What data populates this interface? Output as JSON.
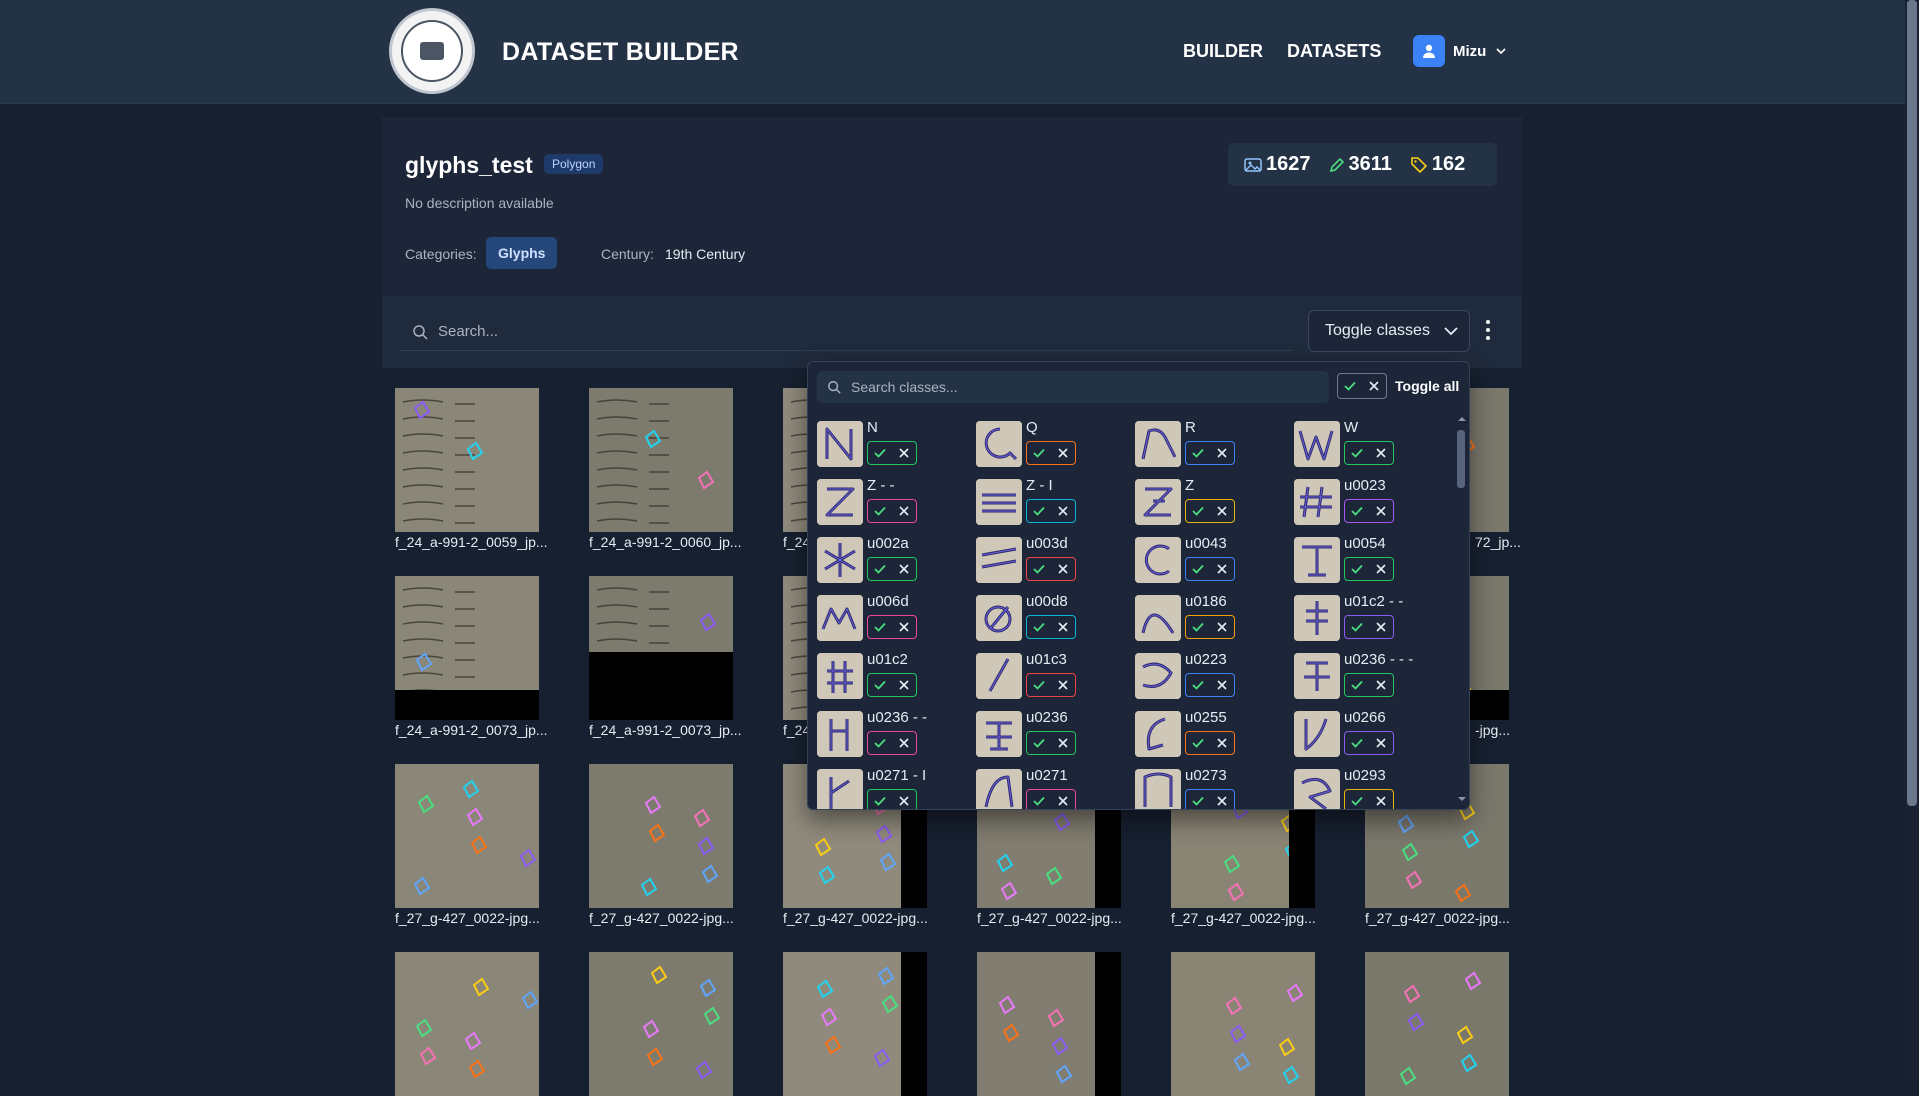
{
  "header": {
    "app_title": "DATASET BUILDER",
    "nav": [
      "BUILDER",
      "DATASETS"
    ],
    "user_name": "Mizu"
  },
  "dataset": {
    "name": "glyphs_test",
    "type_badge": "Polygon",
    "description": "No description available",
    "categories_label": "Categories:",
    "category": "Glyphs",
    "century_label": "Century:",
    "century": "19th Century",
    "stats": {
      "images": "1627",
      "annotations": "3611",
      "classes": "162"
    }
  },
  "toolbar": {
    "search_placeholder": "Search...",
    "toggle_classes_label": "Toggle classes"
  },
  "class_dropdown": {
    "search_placeholder": "Search classes...",
    "toggle_all_label": "Toggle all",
    "classes": [
      {
        "name": "N",
        "color": "#22c55e"
      },
      {
        "name": "Q",
        "color": "#f97316"
      },
      {
        "name": "R",
        "color": "#3b82f6"
      },
      {
        "name": "W",
        "color": "#22c55e"
      },
      {
        "name": "Z - -",
        "color": "#ec4899"
      },
      {
        "name": "Z - I",
        "color": "#06b6d4"
      },
      {
        "name": "Z",
        "color": "#eab308"
      },
      {
        "name": "u0023",
        "color": "#a855f7"
      },
      {
        "name": "u002a",
        "color": "#22c55e"
      },
      {
        "name": "u003d",
        "color": "#ef4444"
      },
      {
        "name": "u0043",
        "color": "#3b82f6"
      },
      {
        "name": "u0054",
        "color": "#22c55e"
      },
      {
        "name": "u006d",
        "color": "#ec4899"
      },
      {
        "name": "u00d8",
        "color": "#06b6d4"
      },
      {
        "name": "u0186",
        "color": "#f59e0b"
      },
      {
        "name": "u01c2 - -",
        "color": "#8b5cf6"
      },
      {
        "name": "u01c2",
        "color": "#22c55e"
      },
      {
        "name": "u01c3",
        "color": "#ef4444"
      },
      {
        "name": "u0223",
        "color": "#3b82f6"
      },
      {
        "name": "u0236 - - -",
        "color": "#22c55e"
      },
      {
        "name": "u0236 - -",
        "color": "#ec4899"
      },
      {
        "name": "u0236",
        "color": "#22c55e"
      },
      {
        "name": "u0255",
        "color": "#f97316"
      },
      {
        "name": "u0266",
        "color": "#8b5cf6"
      },
      {
        "name": "u0271 - I",
        "color": "#22c55e"
      },
      {
        "name": "u0271",
        "color": "#ec4899"
      },
      {
        "name": "u0273",
        "color": "#3b82f6"
      },
      {
        "name": "u0293",
        "color": "#eab308"
      }
    ]
  },
  "images": [
    "f_24_a-991-2_0059_jp...",
    "f_24_a-991-2_0060_jp...",
    "f_24",
    "",
    "",
    "72_jp...",
    "f_24_a-991-2_0073_jp...",
    "f_24_a-991-2_0073_jp...",
    "f_24",
    "",
    "",
    "-jpg...",
    "f_27_g-427_0022-jpg...",
    "f_27_g-427_0022-jpg...",
    "f_27_g-427_0022-jpg...",
    "f_27_g-427_0022-jpg...",
    "f_27_g-427_0022-jpg...",
    "f_27_g-427_0022-jpg...",
    "",
    "",
    "",
    "",
    "",
    ""
  ]
}
